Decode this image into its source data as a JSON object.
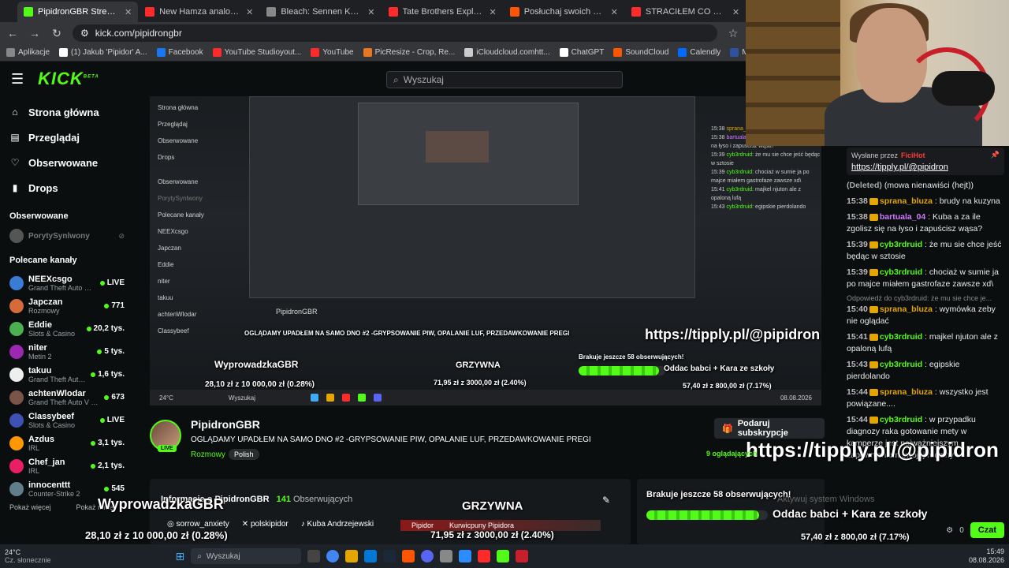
{
  "browser": {
    "tabs": [
      {
        "title": "PipidronGBR Stream - Watch Li",
        "color": "#53fc18",
        "active": true
      },
      {
        "title": "New Hamza analogy for getting",
        "color": "#ff2a2a",
        "active": false
      },
      {
        "title": "Bleach: Sennen Kessen-hen - K",
        "color": "#888888",
        "active": false
      },
      {
        "title": "Tate Brothers Explain Crucial Lif",
        "color": "#ff2a2a",
        "active": false
      },
      {
        "title": "Posłuchaj swoich polubionych",
        "color": "#ff5500",
        "active": false
      },
      {
        "title": "STRACIŁEM CO NAJWAŻNIEJS",
        "color": "#ff2a2a",
        "active": false
      }
    ],
    "url": "kick.com/pipidrongbr",
    "bookmarks": [
      {
        "label": "Aplikacje",
        "color": "#888888"
      },
      {
        "label": "(1) Jakub 'Pipidor' A...",
        "color": "#ffffff"
      },
      {
        "label": "Facebook",
        "color": "#1877f2"
      },
      {
        "label": "YouTube Studioyout...",
        "color": "#ff2a2a"
      },
      {
        "label": "YouTube",
        "color": "#ff2a2a"
      },
      {
        "label": "PicResize - Crop, Re...",
        "color": "#e87722"
      },
      {
        "label": "iCloudcloud.comhtt...",
        "color": "#cccccc"
      },
      {
        "label": "ChatGPT",
        "color": "#ffffff"
      },
      {
        "label": "SoundCloud",
        "color": "#ff5500"
      },
      {
        "label": "Calendly",
        "color": "#006bff"
      },
      {
        "label": "MyAnimeList.net",
        "color": "#2e51a2"
      }
    ]
  },
  "kick": {
    "logo": "KICK",
    "logo_sup": "BETA",
    "search_placeholder": "Wyszukaj",
    "nav": [
      {
        "label": "Strona główna",
        "icon": "home-icon"
      },
      {
        "label": "Przeglądaj",
        "icon": "browse-icon"
      },
      {
        "label": "Obserwowane",
        "icon": "heart-icon"
      },
      {
        "label": "Drops",
        "icon": "drops-icon"
      }
    ],
    "followed_title": "Obserwowane",
    "followed": [
      {
        "name": "PorytySynlwony"
      }
    ],
    "recommended_title": "Polecane kanały",
    "recommended": [
      {
        "name": "NEEXcsgo",
        "category": "Grand Theft Auto V (...",
        "viewers": "LIVE",
        "color": "#3a7bd5"
      },
      {
        "name": "Japczan",
        "category": "Rozmowy",
        "viewers": "771",
        "color": "#d56a3a"
      },
      {
        "name": "Eddie",
        "category": "Slots & Casino",
        "viewers": "20,2 tys.",
        "color": "#4caf50"
      },
      {
        "name": "niter",
        "category": "Metin 2",
        "viewers": "5 tys.",
        "color": "#9c27b0"
      },
      {
        "name": "takuu",
        "category": "Grand Theft Auto ...",
        "viewers": "1,6 tys.",
        "color": "#eeeeee"
      },
      {
        "name": "achtenWlodar",
        "category": "Grand Theft Auto V (G...",
        "viewers": "673",
        "color": "#795548"
      },
      {
        "name": "Classybeef",
        "category": "Slots & Casino",
        "viewers": "LIVE",
        "color": "#3f51b5"
      },
      {
        "name": "Azdus",
        "category": "IRL",
        "viewers": "3,1 tys.",
        "color": "#ff9800"
      },
      {
        "name": "Chef_jan",
        "category": "IRL",
        "viewers": "2,1 tys.",
        "color": "#e91e63"
      },
      {
        "name": "innocenttt",
        "category": "Counter-Strike 2",
        "viewers": "545",
        "color": "#607d8b"
      }
    ],
    "show_more": "Pokaż więcej",
    "show_less": "Pokaż mniej"
  },
  "stream": {
    "name": "PipidronGBR",
    "title": "OGLĄDAMY UPADŁEM NA SAMO DNO #2 -GRYPSOWANIE PIW, OPALANIE LUF, PRZEDAWKOWANIE PREGI",
    "category": "Rozmowy",
    "language": "Polish",
    "live": "LIVE",
    "gift_button": "Podaruj subskrypcje",
    "viewers": "9 oglądających",
    "overlay_url": "https://tipply.pl/@pipidron",
    "followers_label": "Informacje o PipidronGBR",
    "followers_count": "141",
    "followers_word": "Obserwujących",
    "socials": [
      "sorrow_anxiety",
      "polskipidor",
      "Kuba Andrzejewski"
    ],
    "goal_left_title": "WyprowadzkaGBR",
    "goal_left_amount": "28,10 zł z 10 000,00 zł (0.28%)",
    "goal_mid_title": "GRZYWNA",
    "goal_mid_labels": [
      "Pipidor",
      "Kurwicpuny Pipidora"
    ],
    "goal_mid_amount": "71,95 zł z 3000,00 zł (2.40%)",
    "goal_right_title": "Brakuje jeszcze 58 obserwujących!",
    "goal_right_label": "Oddac babci + Kara ze szkoły",
    "goal_right_amount": "57,40 zł z 800,00 zł (7.17%)",
    "activate_windows": "Aktywuj system Windows",
    "mini_title": "PipidronGBR"
  },
  "chat": {
    "pinned_label": "Wysłane przez",
    "pinned_by": "FiciHot",
    "pinned_url": "https://tipply.pl/@pipidron",
    "messages": [
      {
        "time": "",
        "user": "(Deleted)",
        "color": "#aaaaaa",
        "text": "(mowa nienawiści (hejt))",
        "reply": ""
      },
      {
        "time": "15:38",
        "user": "sprana_bluza",
        "color": "#e5a600",
        "text": ": brudy na kuzyna",
        "reply": ""
      },
      {
        "time": "15:38",
        "user": "bartuala_04",
        "color": "#d07bff",
        "text": ": Kuba a za ile zgolisz się na łyso i zapuścisz wąsa?",
        "reply": ""
      },
      {
        "time": "15:39",
        "user": "cyb3rdruid",
        "color": "#53fc18",
        "text": ": że mu sie chce jeść będąc w sztosie",
        "reply": ""
      },
      {
        "time": "15:39",
        "user": "cyb3rdruid",
        "color": "#53fc18",
        "text": ": chociaż w sumie ja po majce miałem gastrofaze zawsze xd\\",
        "reply": ""
      },
      {
        "time": "15:40",
        "user": "sprana_bluza",
        "color": "#e5a600",
        "text": ": wymówka zeby nie oglądać",
        "reply": "Odpowiedź do cyb3rdruid: że mu sie chce je..."
      },
      {
        "time": "15:41",
        "user": "cyb3rdruid",
        "color": "#53fc18",
        "text": ": majkel njuton ale z opaloną lufą",
        "reply": ""
      },
      {
        "time": "15:43",
        "user": "cyb3rdruid",
        "color": "#53fc18",
        "text": ": egipskie pierdolando",
        "reply": ""
      },
      {
        "time": "15:44",
        "user": "sprana_bluza",
        "color": "#e5a600",
        "text": ": wszystko jest powiązane....",
        "reply": ""
      },
      {
        "time": "15:44",
        "user": "cyb3rdruid",
        "color": "#53fc18",
        "text": ": w przypadku diagnozy raka gotowanie mety w kamperze jest najważniejszym zapewnieniem swojej rodziny",
        "reply": ""
      }
    ],
    "counter": "0",
    "send_label": "Czat"
  },
  "taskbar": {
    "temp": "24°C",
    "weather": "Cz. słonecznie",
    "search": "Wyszukaj",
    "time": "15:49",
    "date": "08.08.2026"
  }
}
